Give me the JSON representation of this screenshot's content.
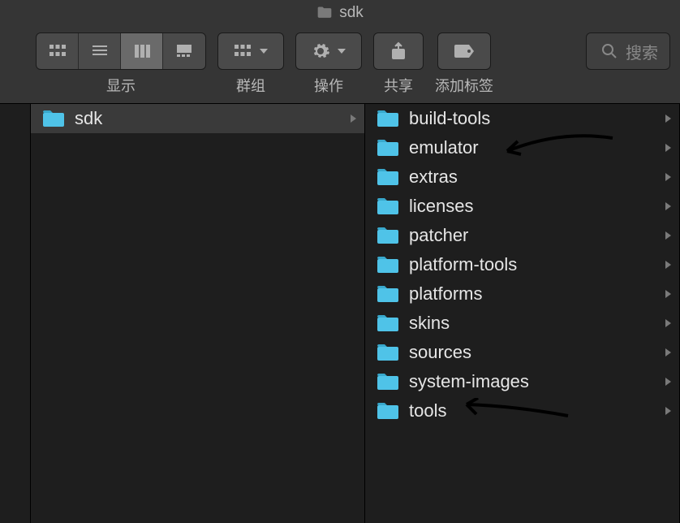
{
  "window": {
    "title": "sdk"
  },
  "toolbar": {
    "view_label": "显示",
    "group_label": "群组",
    "action_label": "操作",
    "share_label": "共享",
    "tags_label": "添加标签",
    "search_placeholder": "搜索"
  },
  "column1": {
    "items": [
      {
        "name": "sdk",
        "selected": true,
        "has_children": true
      }
    ]
  },
  "column2": {
    "items": [
      {
        "name": "build-tools",
        "has_children": true
      },
      {
        "name": "emulator",
        "has_children": true,
        "annotated": true
      },
      {
        "name": "extras",
        "has_children": true
      },
      {
        "name": "licenses",
        "has_children": true
      },
      {
        "name": "patcher",
        "has_children": true
      },
      {
        "name": "platform-tools",
        "has_children": true
      },
      {
        "name": "platforms",
        "has_children": true
      },
      {
        "name": "skins",
        "has_children": true
      },
      {
        "name": "sources",
        "has_children": true
      },
      {
        "name": "system-images",
        "has_children": true
      },
      {
        "name": "tools",
        "has_children": true,
        "annotated": true
      }
    ]
  },
  "colors": {
    "folder": "#4fc3e8",
    "folder_tab": "#38a8cc"
  }
}
